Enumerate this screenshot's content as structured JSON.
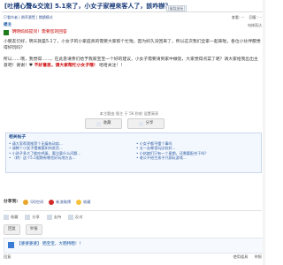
{
  "thread": {
    "title": "[吐槽心聲&交流] 5.1來了，小女子家裡來客人了，該咋辦？",
    "copy_link": "[複製鏈接]"
  },
  "meta": {
    "left_text": "只看作者 | 倒序瀏覽 | 閱讀模式",
    "right": [
      "查看: ···",
      "回復: ···"
    ]
  },
  "post": {
    "author": "楼主",
    "floor": "电梯直达",
    "notice": "明明妈妈提问！需要您的回答",
    "paragraphs": [
      "小朋友们好，明天就是5.1了，小女子的小家庭真的需要大家帮个忙啦，因为好久没回来了，所以这次我们全家一起来啦，各位小伙伴都觉得好玩吗？",
      "所以……哦，我觉得……，在此恳请亲们给予我家宝宝一个好的建议，小女子需要请到家中做饭，大家觉得点菜了呢？请大家给我出出主意吧！谢谢！♥"
    ],
    "hl_text": "不好意思，请大家帮忙小女子哦！",
    "tail": "哈哈关注！！"
  },
  "edit_note": "本主题由 版主 于 56 秒前 设置高亮",
  "save": {
    "label_left": "收藏",
    "label_right": "分享"
  },
  "related": {
    "title": "相关帖子",
    "left": [
      "• 请大家帮我推荐个无痛电动扇...",
      "• 请教个小女子摆摊要如何进货...",
      "• 小孩子多大了能吃鸡蛋，要注意什么问题...",
      "• （转）这个5.1假期有哪些好玩地方去..."
    ],
    "right": [
      "• 小女子都不懂个事吗",
      "• 五一去哪里玩比较好...",
      "• 小姑娘们只有一个星期，还需要配合干吗？",
      "• 老公不给生孩子只顾玩游戏..."
    ]
  },
  "share": {
    "label": "分享到:",
    "items": [
      "QQ空间",
      "新浪微博",
      "收藏"
    ]
  },
  "actions": {
    "items": [
      "收藏",
      "分享",
      "支持",
      "反对"
    ]
  },
  "row3": {
    "buttons": [
      "回复",
      "举报"
    ]
  },
  "sign": {
    "text": "【婆婆婆婆】 晒宝宝，大晒特晒！！"
  },
  "footer": {
    "left": "回复",
    "right": [
      "使用道具",
      "举报"
    ]
  }
}
